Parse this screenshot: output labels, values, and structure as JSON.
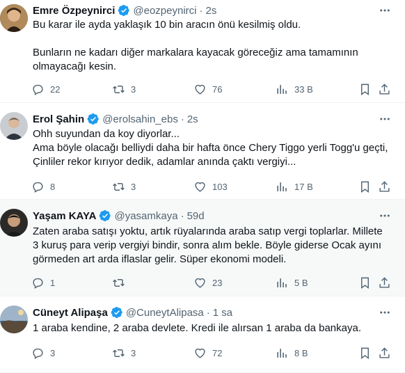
{
  "tweets": [
    {
      "name": "Emre Özpeynirci",
      "handle": "@eozpeynirci",
      "time": "2s",
      "paragraphs": [
        "Bu karar ile ayda yaklaşık 10 bin aracın önü kesilmiş oldu.",
        "",
        "Bunların ne kadarı diğer markalara kayacak göreceğiz ama tamamının olmayacağı kesin."
      ],
      "replies": "22",
      "retweets": "3",
      "likes": "76",
      "views": "33 B",
      "avatar_color": "#6b4e2e"
    },
    {
      "name": "Erol Şahin",
      "handle": "@erolsahin_ebs",
      "time": "2s",
      "paragraphs": [
        "Ohh suyundan da koy diyorlar...",
        "Ama böyle olacağı belliydi daha bir hafta önce Chery Tiggo yerli Togg'u geçti, Çinliler rekor kırıyor dedik, adamlar anında çaktı vergiyi..."
      ],
      "replies": "8",
      "retweets": "3",
      "likes": "103",
      "views": "17 B",
      "avatar_color": "#8a8f96"
    },
    {
      "name": "Yaşam KAYA",
      "handle": "@yasamkaya",
      "time": "59d",
      "paragraphs": [
        "Zaten araba satışı yoktu, artık rüyalarında araba satıp vergi toplarlar. Millete 3 kuruş para verip vergiyi bindir, sonra alım bekle. Böyle giderse Ocak ayını görmeden art arda iflaslar gelir. Süper ekonomi modeli."
      ],
      "replies": "1",
      "retweets": "",
      "likes": "23",
      "views": "5 B",
      "avatar_color": "#3d3a36"
    },
    {
      "name": "Cüneyt Alipaşa",
      "handle": "@CuneytAlipasa",
      "time": "1 sa",
      "paragraphs": [
        "1 araba kendine, 2 araba devlete. Kredi ile alırsan 1 araba da bankaya."
      ],
      "replies": "3",
      "retweets": "3",
      "likes": "72",
      "views": "8 B",
      "avatar_color": "#7b8fa6"
    }
  ],
  "colors": {
    "verified": "#1d9bf0",
    "muted": "#536471",
    "text": "#0f1419",
    "shaded_bg": "#f7f9f9"
  },
  "icons": [
    "verified-badge-icon",
    "more-icon",
    "reply-icon",
    "retweet-icon",
    "like-icon",
    "views-icon",
    "bookmark-icon",
    "share-icon"
  ],
  "separator": "·"
}
